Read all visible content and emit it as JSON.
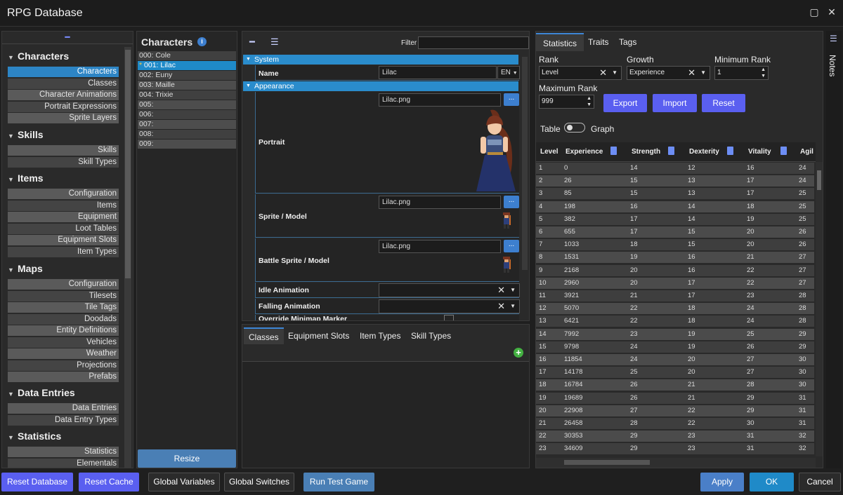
{
  "window": {
    "title": "RPG Database"
  },
  "tree": {
    "groups": [
      {
        "title": "Characters",
        "items": [
          "Characters",
          "Classes",
          "Character Animations",
          "Portrait Expressions",
          "Sprite Layers"
        ]
      },
      {
        "title": "Skills",
        "items": [
          "Skills",
          "Skill Types"
        ]
      },
      {
        "title": "Items",
        "items": [
          "Configuration",
          "Items",
          "Equipment",
          "Loot Tables",
          "Equipment Slots",
          "Item Types"
        ]
      },
      {
        "title": "Maps",
        "items": [
          "Configuration",
          "Tilesets",
          "Tile Tags",
          "Doodads",
          "Entity Definitions",
          "Vehicles",
          "Weather",
          "Projections",
          "Prefabs"
        ]
      },
      {
        "title": "Data Entries",
        "items": [
          "Data Entries",
          "Data Entry Types"
        ]
      },
      {
        "title": "Statistics",
        "items": [
          "Statistics",
          "Elementals"
        ]
      }
    ]
  },
  "characters": {
    "title": "Characters",
    "rows": [
      "000: Cole",
      "001: Lilac",
      "002: Euny",
      "003: Maille",
      "004: Trixie",
      "005:",
      "006:",
      "007:",
      "008:",
      "009:"
    ],
    "selected_marker": "*",
    "resize_label": "Resize"
  },
  "editor": {
    "filter_label": "Filter",
    "sections": {
      "system": "System",
      "appearance": "Appearance"
    },
    "name_label": "Name",
    "name_value": "Lilac",
    "lang": "EN",
    "portrait_label": "Portrait",
    "portrait_file": "Lilac.png",
    "sprite_label": "Sprite / Model",
    "sprite_file": "Lilac.png",
    "battle_label": "Battle Sprite / Model",
    "battle_file": "Lilac.png",
    "idle_label": "Idle Animation",
    "falling_label": "Falling Animation",
    "override_label": "Override Minimap Marker",
    "browse": "..."
  },
  "subtabs": [
    "Classes",
    "Equipment Slots",
    "Item Types",
    "Skill Types"
  ],
  "stats": {
    "tabs": [
      "Statistics",
      "Traits",
      "Tags"
    ],
    "rank_label": "Rank",
    "rank_value": "Level",
    "growth_label": "Growth",
    "growth_value": "Experience",
    "min_rank_label": "Minimum Rank",
    "min_rank_value": "1",
    "max_rank_label": "Maximum Rank",
    "max_rank_value": "999",
    "export": "Export",
    "import": "Import",
    "reset": "Reset",
    "table_label": "Table",
    "graph_label": "Graph",
    "columns": [
      "Level",
      "Experience",
      "Strength",
      "Dexterity",
      "Vitality",
      "Agil"
    ],
    "rows": [
      [
        "1",
        "0",
        "14",
        "12",
        "16",
        "24"
      ],
      [
        "2",
        "26",
        "15",
        "13",
        "17",
        "24"
      ],
      [
        "3",
        "85",
        "15",
        "13",
        "17",
        "25"
      ],
      [
        "4",
        "198",
        "16",
        "14",
        "18",
        "25"
      ],
      [
        "5",
        "382",
        "17",
        "14",
        "19",
        "25"
      ],
      [
        "6",
        "655",
        "17",
        "15",
        "20",
        "26"
      ],
      [
        "7",
        "1033",
        "18",
        "15",
        "20",
        "26"
      ],
      [
        "8",
        "1531",
        "19",
        "16",
        "21",
        "27"
      ],
      [
        "9",
        "2168",
        "20",
        "16",
        "22",
        "27"
      ],
      [
        "10",
        "2960",
        "20",
        "17",
        "22",
        "27"
      ],
      [
        "11",
        "3921",
        "21",
        "17",
        "23",
        "28"
      ],
      [
        "12",
        "5070",
        "22",
        "18",
        "24",
        "28"
      ],
      [
        "13",
        "6421",
        "22",
        "18",
        "24",
        "28"
      ],
      [
        "14",
        "7992",
        "23",
        "19",
        "25",
        "29"
      ],
      [
        "15",
        "9798",
        "24",
        "19",
        "26",
        "29"
      ],
      [
        "16",
        "11854",
        "24",
        "20",
        "27",
        "30"
      ],
      [
        "17",
        "14178",
        "25",
        "20",
        "27",
        "30"
      ],
      [
        "18",
        "16784",
        "26",
        "21",
        "28",
        "30"
      ],
      [
        "19",
        "19689",
        "26",
        "21",
        "29",
        "31"
      ],
      [
        "20",
        "22908",
        "27",
        "22",
        "29",
        "31"
      ],
      [
        "21",
        "26458",
        "28",
        "22",
        "30",
        "31"
      ],
      [
        "22",
        "30353",
        "29",
        "23",
        "31",
        "32"
      ],
      [
        "23",
        "34609",
        "29",
        "23",
        "31",
        "32"
      ]
    ]
  },
  "notes_label": "Notes",
  "footer": {
    "reset_database": "Reset Database",
    "reset_cache": "Reset Cache",
    "global_variables": "Global Variables",
    "global_switches": "Global Switches",
    "run_test_game": "Run Test Game",
    "apply": "Apply",
    "ok": "OK",
    "cancel": "Cancel"
  },
  "colors": {
    "accent": "#1f8ac8",
    "purple": "#5a5ff0",
    "selected": "#2d85c5"
  }
}
